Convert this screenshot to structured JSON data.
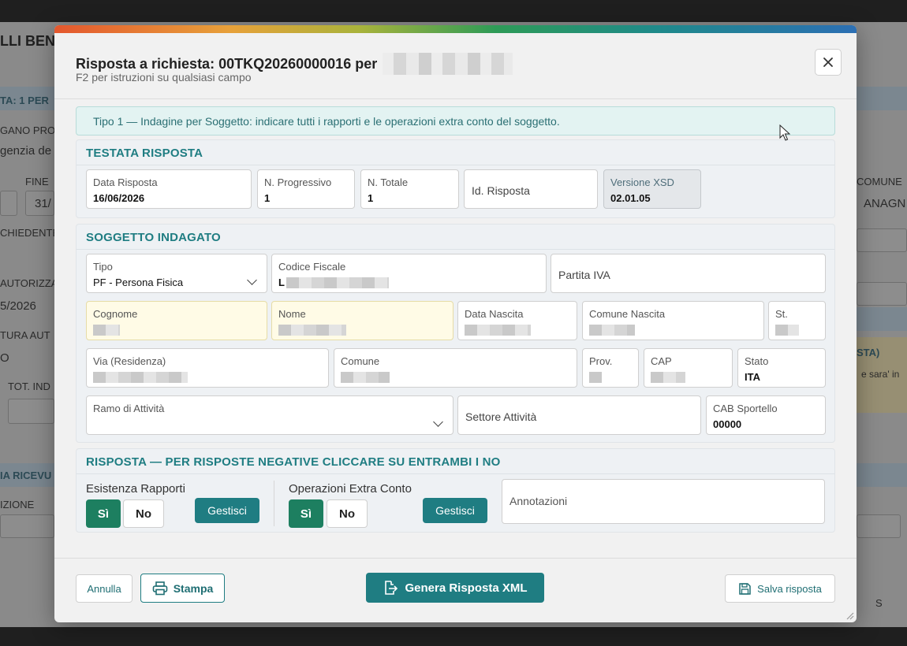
{
  "background": {
    "texts": [
      "LLI BEN",
      "TA: 1 PER",
      "GANO PRO",
      "genzia de",
      "FINE",
      "31/",
      "CHIEDENTE",
      "AUTORIZZA",
      "5/2026",
      "TURA AUT",
      "O",
      "TOT. IND",
      "IA RICEVU",
      "IZIONE",
      "COMUNE",
      "ANAGN",
      "STA)",
      "e sara' in",
      "S"
    ]
  },
  "modal": {
    "title_prefix": "Risposta a richiesta: 00TKQ20260000016 per",
    "subtitle": "F2 per istruzioni su qualsiasi campo",
    "info_banner": "Tipo 1 — Indagine per Soggetto: indicare tutti i rapporti e le operazioni extra conto del soggetto.",
    "testata": {
      "title": "TESTATA RISPOSTA",
      "data_risposta": {
        "label": "Data Risposta",
        "value": "16/06/2026"
      },
      "n_progressivo": {
        "label": "N. Progressivo",
        "value": "1"
      },
      "n_totale": {
        "label": "N. Totale",
        "value": "1"
      },
      "id_risposta": {
        "placeholder": "Id. Risposta"
      },
      "versione_xsd": {
        "label": "Versione XSD",
        "value": "02.01.05"
      }
    },
    "soggetto": {
      "title": "SOGGETTO INDAGATO",
      "tipo": {
        "label": "Tipo",
        "value": "PF - Persona Fisica"
      },
      "codice_fiscale": {
        "label": "Codice Fiscale",
        "value": "L"
      },
      "partita_iva": {
        "placeholder": "Partita IVA"
      },
      "cognome": {
        "label": "Cognome"
      },
      "nome": {
        "label": "Nome"
      },
      "data_nascita": {
        "label": "Data Nascita"
      },
      "comune_nascita": {
        "label": "Comune Nascita"
      },
      "st": {
        "label": "St."
      },
      "via": {
        "label": "Via (Residenza)"
      },
      "comune": {
        "label": "Comune"
      },
      "prov": {
        "label": "Prov."
      },
      "cap": {
        "label": "CAP"
      },
      "stato": {
        "label": "Stato",
        "value": "ITA"
      },
      "ramo": {
        "label": "Ramo di Attività"
      },
      "settore": {
        "placeholder": "Settore Attività"
      },
      "cab": {
        "label": "CAB Sportello",
        "value": "00000"
      }
    },
    "risposta": {
      "title": "RISPOSTA — PER RISPOSTE NEGATIVE CLICCARE SU ENTRAMBI I NO",
      "esistenza_label": "Esistenza Rapporti",
      "operazioni_label": "Operazioni Extra Conto",
      "si": "Sì",
      "no": "No",
      "gestisci": "Gestisci",
      "annotazioni_placeholder": "Annotazioni"
    },
    "footer": {
      "annulla": "Annulla",
      "stampa": "Stampa",
      "genera_xml": "Genera Risposta XML",
      "salva": "Salva risposta"
    }
  },
  "colors": {
    "accent": "#1f7d82",
    "yes_button": "#1d7f60",
    "banner_bg": "#e3f3f2"
  },
  "icons": [
    "close-icon",
    "chevron-down-icon",
    "printer-icon",
    "file-export-icon",
    "save-icon",
    "mouse-cursor-icon"
  ]
}
